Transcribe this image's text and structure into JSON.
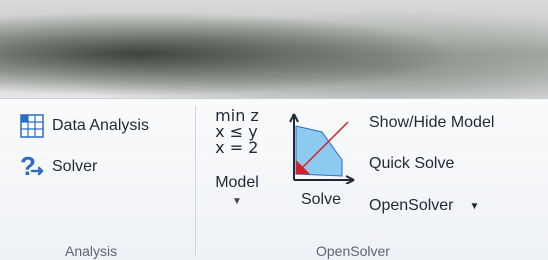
{
  "analysis_group": {
    "title": "Analysis",
    "data_analysis_label": "Data Analysis",
    "solver_label": "Solver"
  },
  "opensolver_group": {
    "title": "OpenSolver",
    "model_label": "Model",
    "solve_label": "Solve",
    "show_hide_label": "Show/Hide Model",
    "quick_solve_label": "Quick Solve",
    "opensolver_label": "OpenSolver",
    "math_lines": [
      "min z",
      "x ≤ y",
      "x = 2"
    ]
  },
  "colors": {
    "accent_blue": "#2b6cc4",
    "solve_fill": "#8ccaf0",
    "solve_red": "#d51f2b"
  }
}
